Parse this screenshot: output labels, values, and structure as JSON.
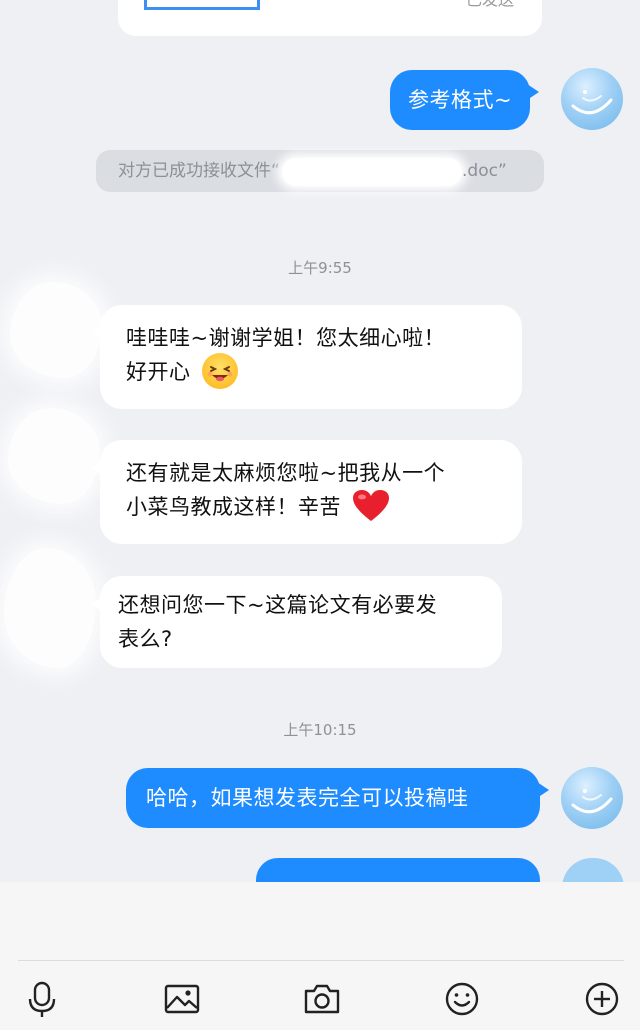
{
  "top_file_card": {
    "status": "已发送"
  },
  "messages": {
    "outgoing_format": "参考格式~",
    "system_notice_prefix": "对方已成功接收文件“",
    "system_notice_suffix": ".doc”",
    "time_1": "上午9:55",
    "incoming_1_line1": "哇哇哇~谢谢学姐！您太细心啦！",
    "incoming_1_line2": "好开心",
    "incoming_2_line1": "还有就是太麻烦您啦~把我从一个",
    "incoming_2_line2": "小菜鸟教成这样！辛苦",
    "incoming_3_line1": "还想问您一下~这篇论文有必要发",
    "incoming_3_line2": "表么?",
    "time_2": "上午10:15",
    "outgoing_reply": "哈哈，如果想发表完全可以投稿哇"
  },
  "toolbar": {
    "icons": [
      "microphone-icon",
      "image-icon",
      "camera-icon",
      "emoji-icon",
      "plus-icon"
    ]
  },
  "colors": {
    "outgoing_bubble": "#1e8bff",
    "incoming_bubble": "#ffffff",
    "background": "#eef0f4",
    "system_text": "#8d9197"
  }
}
